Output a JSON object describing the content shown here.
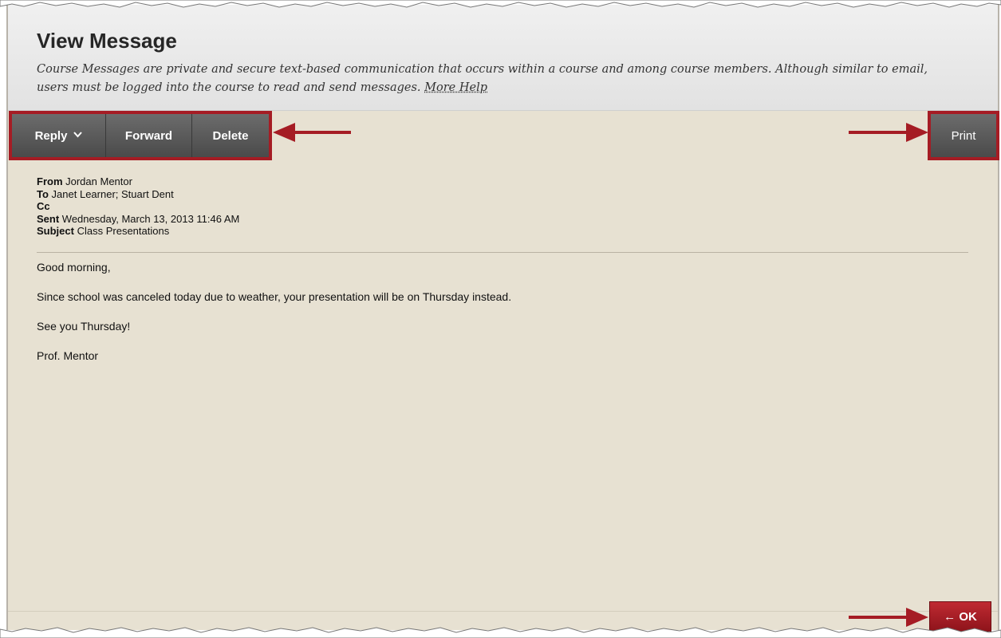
{
  "page": {
    "title": "View Message",
    "description": "Course Messages are private and secure text-based communication that occurs within a course and among course members. Although similar to email, users must be logged into the course to read and send messages. ",
    "more_help": "More Help"
  },
  "toolbar": {
    "reply": "Reply",
    "forward": "Forward",
    "delete": "Delete",
    "print": "Print"
  },
  "message": {
    "from_label": "From",
    "from_value": "Jordan Mentor",
    "to_label": "To",
    "to_value": "Janet Learner; Stuart Dent",
    "cc_label": "Cc",
    "cc_value": "",
    "sent_label": "Sent",
    "sent_value": "Wednesday, March 13, 2013 11:46 AM",
    "subject_label": "Subject",
    "subject_value": "Class Presentations",
    "body": [
      "Good morning,",
      "Since school was canceled today due to weather, your presentation will be on Thursday instead.",
      "See you Thursday!",
      "Prof. Mentor"
    ]
  },
  "footer": {
    "ok": "← OK"
  },
  "colors": {
    "highlight": "#a51c24",
    "content_bg": "#e7e1d2",
    "ok_button": "#a51c24"
  },
  "icons": {
    "reply_chevron": "chevron-down-icon",
    "annotation_arrows": "arrow-icon"
  }
}
